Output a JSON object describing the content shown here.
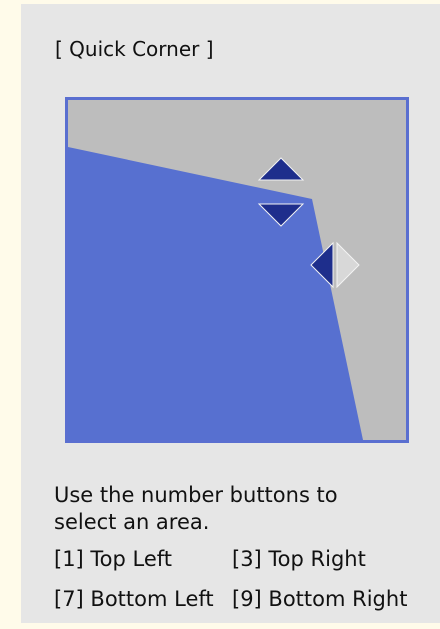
{
  "title": "[ Quick Corner ]",
  "instructions": {
    "line1": "Use the number buttons to",
    "line2": "select an area."
  },
  "keys": {
    "top_left": "[1] Top Left",
    "top_right": "[3] Top Right",
    "bottom_left": "[7] Bottom Left",
    "bottom_right": "[9] Bottom Right"
  },
  "colors": {
    "page_background": "#fffbea",
    "panel_background": "#e6e6e6",
    "preview_background": "#bdbdbd",
    "preview_border": "#5a6fd0",
    "image_area": "#5770d0",
    "active_arrow": "#1e2e8c",
    "inactive_arrow": "#d8d8d8"
  },
  "icons": {
    "up": "triangle-up-icon",
    "down": "triangle-down-icon",
    "left": "triangle-left-icon",
    "right": "triangle-right-icon"
  }
}
